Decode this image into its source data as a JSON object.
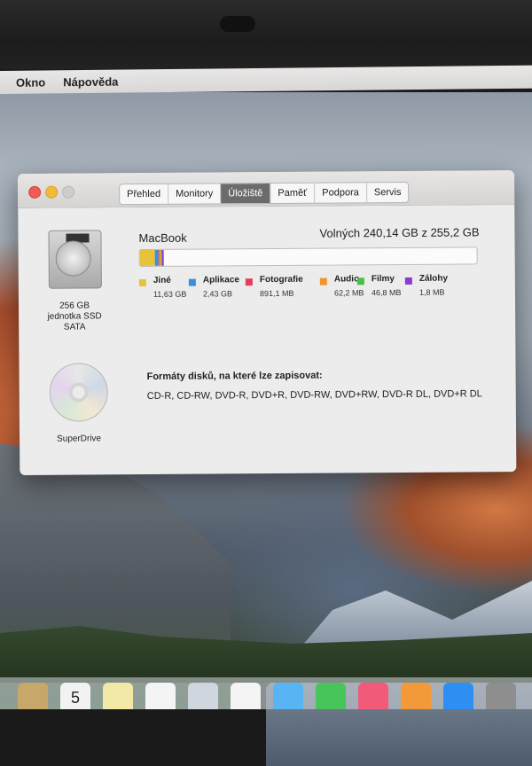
{
  "menubar": {
    "items": [
      "Okno",
      "Nápověda"
    ]
  },
  "window": {
    "tabs": [
      {
        "label": "Přehled",
        "active": false
      },
      {
        "label": "Monitory",
        "active": false
      },
      {
        "label": "Úložiště",
        "active": true
      },
      {
        "label": "Paměť",
        "active": false
      },
      {
        "label": "Podpora",
        "active": false
      },
      {
        "label": "Servis",
        "active": false
      }
    ],
    "devices": {
      "ssd": {
        "label_line1": "256 GB",
        "label_line2": "jednotka SSD",
        "label_line3": "SATA",
        "icon": "hard-drive-icon"
      },
      "superdrive": {
        "label": "SuperDrive",
        "icon": "optical-disc-icon"
      }
    },
    "storage": {
      "volume_name": "MacBook",
      "free_text": "Volných 240,14 GB z 255,2 GB",
      "total_gb": 255.2,
      "segments": [
        {
          "name": "Jiné",
          "value_text": "11,63 GB",
          "gb": 11.63,
          "color": "#e8c23a"
        },
        {
          "name": "Aplikace",
          "value_text": "2,43 GB",
          "gb": 2.43,
          "color": "#3b8fd8"
        },
        {
          "name": "Fotografie",
          "value_text": "891,1 MB",
          "gb": 0.891,
          "color": "#e63b5a"
        },
        {
          "name": "Audio",
          "value_text": "62,2 MB",
          "gb": 0.0622,
          "color": "#f0962c"
        },
        {
          "name": "Filmy",
          "value_text": "46,8 MB",
          "gb": 0.0468,
          "color": "#45c246"
        },
        {
          "name": "Zálohy",
          "value_text": "1,8 MB",
          "gb": 0.0018,
          "color": "#8a3bd1"
        }
      ]
    },
    "formats": {
      "title": "Formáty disků, na které lze zapisovat:",
      "list": "CD-R, CD-RW, DVD-R, DVD+R, DVD-RW, DVD+RW, DVD-R DL, DVD+R DL"
    }
  },
  "dock": {
    "icons": [
      {
        "name": "contacts-app-icon",
        "color": "#c8a76a"
      },
      {
        "name": "calendar-app-icon",
        "color": "#f2f2f2",
        "text": "5"
      },
      {
        "name": "notes-app-icon",
        "color": "#f3e9a6"
      },
      {
        "name": "reminders-app-icon",
        "color": "#f4f4f4"
      },
      {
        "name": "preview-app-icon",
        "color": "#cfd6dd"
      },
      {
        "name": "photos-app-icon",
        "color": "#f4f4f4"
      },
      {
        "name": "messages-app-icon",
        "color": "#58b4f2"
      },
      {
        "name": "facetime-app-icon",
        "color": "#47c45a"
      },
      {
        "name": "itunes-app-icon",
        "color": "#f25a7a"
      },
      {
        "name": "ibooks-app-icon",
        "color": "#f29a3a"
      },
      {
        "name": "app-store-icon",
        "color": "#2d8ff2"
      },
      {
        "name": "system-preferences-icon",
        "color": "#8e8e8e"
      }
    ]
  }
}
